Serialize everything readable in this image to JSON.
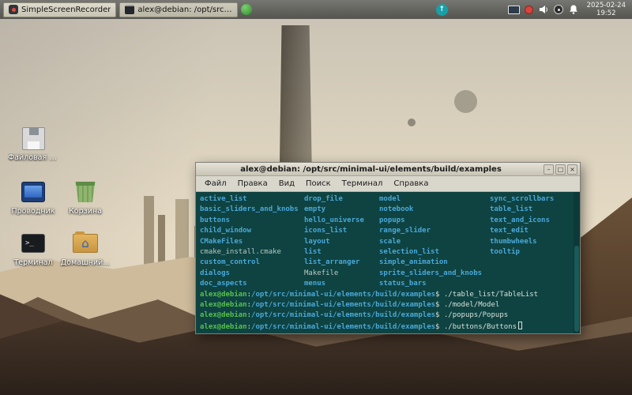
{
  "panel": {
    "windows": [
      {
        "label": "SimpleScreenRecorder"
      },
      {
        "label": "alex@debian: /opt/src/mi..."
      }
    ],
    "tray_icons": [
      "updates",
      "display",
      "record",
      "volume",
      "audio-mixer",
      "notifications"
    ],
    "clock": {
      "date": "2025-02-24",
      "time": "19:52"
    }
  },
  "desktop": {
    "icons": [
      {
        "label": "Файловая с..."
      },
      {
        "label": "Проводник"
      },
      {
        "label": "Корзина"
      },
      {
        "label": "Терминал"
      },
      {
        "label": "Домашний..."
      }
    ]
  },
  "terminal": {
    "title": "alex@debian: /opt/src/minimal-ui/elements/build/examples",
    "menu": [
      "Файл",
      "Правка",
      "Вид",
      "Поиск",
      "Терминал",
      "Справка"
    ],
    "window_buttons": [
      "–",
      "□",
      "×"
    ],
    "colors": {
      "bg": "#0e4342",
      "dir": "#4aa8d8",
      "file": "#bcc8c0",
      "user": "#57c04a",
      "path": "#4aa8d8",
      "text": "#d8e0d8"
    },
    "listing": {
      "rows": [
        [
          {
            "text": "active_list",
            "type": "dir"
          },
          {
            "text": "drop_file",
            "type": "dir"
          },
          {
            "text": "model",
            "type": "dir"
          },
          {
            "text": "sync_scrollbars",
            "type": "dir"
          }
        ],
        [
          {
            "text": "basic_sliders_and_knobs",
            "type": "dir"
          },
          {
            "text": "empty",
            "type": "dir"
          },
          {
            "text": "notebook",
            "type": "dir"
          },
          {
            "text": "table_list",
            "type": "dir"
          }
        ],
        [
          {
            "text": "buttons",
            "type": "dir"
          },
          {
            "text": "hello_universe",
            "type": "dir"
          },
          {
            "text": "popups",
            "type": "dir"
          },
          {
            "text": "text_and_icons",
            "type": "dir"
          }
        ],
        [
          {
            "text": "child_window",
            "type": "dir"
          },
          {
            "text": "icons_list",
            "type": "dir"
          },
          {
            "text": "range_slider",
            "type": "dir"
          },
          {
            "text": "text_edit",
            "type": "dir"
          }
        ],
        [
          {
            "text": "CMakeFiles",
            "type": "dir"
          },
          {
            "text": "layout",
            "type": "dir"
          },
          {
            "text": "scale",
            "type": "dir"
          },
          {
            "text": "thumbwheels",
            "type": "dir"
          }
        ],
        [
          {
            "text": "cmake_install.cmake",
            "type": "file"
          },
          {
            "text": "list",
            "type": "dir"
          },
          {
            "text": "selection_list",
            "type": "dir"
          },
          {
            "text": "tooltip",
            "type": "dir"
          }
        ],
        [
          {
            "text": "custom_control",
            "type": "dir"
          },
          {
            "text": "list_arranger",
            "type": "dir"
          },
          {
            "text": "simple_animation",
            "type": "dir"
          },
          null
        ],
        [
          {
            "text": "dialogs",
            "type": "dir"
          },
          {
            "text": "Makefile",
            "type": "file"
          },
          {
            "text": "sprite_sliders_and_knobs",
            "type": "dir"
          },
          null
        ],
        [
          {
            "text": "doc_aspects",
            "type": "dir"
          },
          {
            "text": "menus",
            "type": "dir"
          },
          {
            "text": "status_bars",
            "type": "dir"
          },
          null
        ]
      ]
    },
    "prompts": [
      {
        "user": "alex@debian",
        "path": "/opt/src/minimal-ui/elements/build/examples",
        "command": "./table_list/TableList",
        "cursor": false
      },
      {
        "user": "alex@debian",
        "path": "/opt/src/minimal-ui/elements/build/examples",
        "command": "./model/Model",
        "cursor": false
      },
      {
        "user": "alex@debian",
        "path": "/opt/src/minimal-ui/elements/build/examples",
        "command": "./popups/Popups",
        "cursor": false
      },
      {
        "user": "alex@debian",
        "path": "/opt/src/minimal-ui/elements/build/examples",
        "command": "./buttons/Buttons",
        "cursor": true
      }
    ]
  }
}
